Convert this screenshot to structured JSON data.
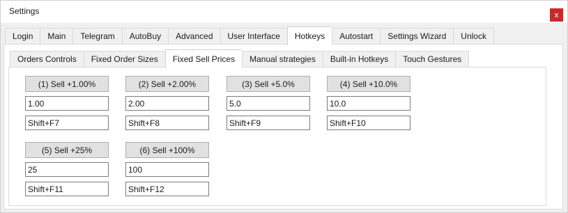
{
  "window": {
    "title": "Settings",
    "close_glyph": "x"
  },
  "main_tabs": [
    {
      "label": "Login"
    },
    {
      "label": "Main"
    },
    {
      "label": "Telegram"
    },
    {
      "label": "AutoBuy"
    },
    {
      "label": "Advanced"
    },
    {
      "label": "User Interface"
    },
    {
      "label": "Hotkeys",
      "active": true
    },
    {
      "label": "Autostart"
    },
    {
      "label": "Settings Wizard"
    },
    {
      "label": "Unlock"
    }
  ],
  "sub_tabs": [
    {
      "label": "Orders Controls"
    },
    {
      "label": "Fixed Order Sizes"
    },
    {
      "label": "Fixed Sell Prices",
      "active": true
    },
    {
      "label": "Manual strategies"
    },
    {
      "label": "Built-in Hotkeys"
    },
    {
      "label": "Touch Gestures"
    }
  ],
  "sell_groups": [
    {
      "button": "(1) Sell +1.00%",
      "value": "1.00",
      "hotkey": "Shift+F7"
    },
    {
      "button": "(2) Sell +2.00%",
      "value": "2.00",
      "hotkey": "Shift+F8"
    },
    {
      "button": "(3) Sell +5.0%",
      "value": "5.0",
      "hotkey": "Shift+F9"
    },
    {
      "button": "(4) Sell +10.0%",
      "value": "10.0",
      "hotkey": "Shift+F10"
    },
    {
      "button": "(5) Sell +25%",
      "value": "25",
      "hotkey": "Shift+F11"
    },
    {
      "button": "(6) Sell +100%",
      "value": "100",
      "hotkey": "Shift+F12"
    }
  ],
  "colors": {
    "close_button": "#c42b2b",
    "client_bg": "#f0f0f0",
    "button_bg": "#e1e1e1"
  }
}
